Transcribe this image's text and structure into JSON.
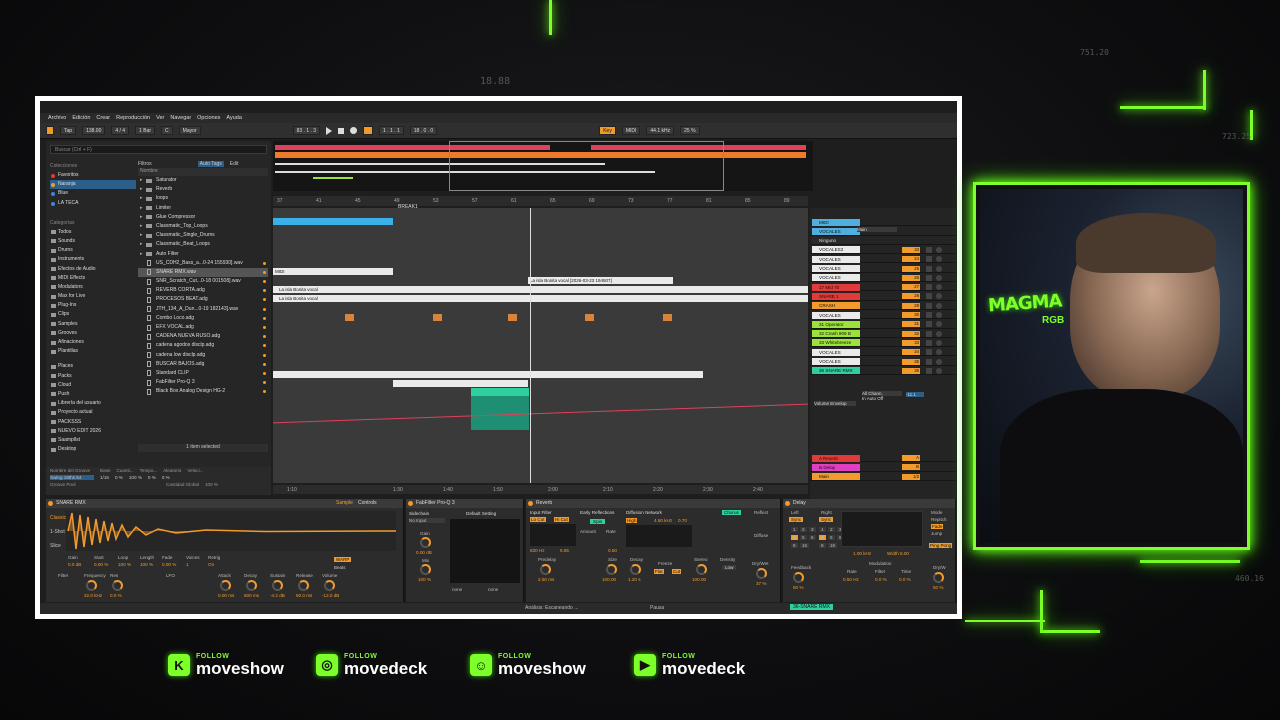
{
  "stream": {
    "bg_numbers": [
      "18.88",
      "751.20",
      "723.25",
      "460.16"
    ],
    "socials": [
      {
        "icon": "kick-icon",
        "glyph": "K",
        "follow": "FOLLOW",
        "handle": "moveshow"
      },
      {
        "icon": "instagram-icon",
        "glyph": "◎",
        "follow": "FOLLOW",
        "handle": "movedeck"
      },
      {
        "icon": "discord-icon",
        "glyph": "☺",
        "follow": "FOLLOW",
        "handle": "moveshow"
      },
      {
        "icon": "youtube-icon",
        "glyph": "▶",
        "follow": "FOLLOW",
        "handle": "movedeck"
      }
    ],
    "webcam": {
      "logo_main": "MAGMA",
      "logo_sub": "RGB"
    },
    "accent": "#7dff2a"
  },
  "ableton": {
    "menu": [
      "Archivo",
      "Edición",
      "Crear",
      "Reproducción",
      "Ver",
      "Navegar",
      "Opciones",
      "Ayuda"
    ],
    "transport": {
      "tap": "Tap",
      "tempo": "138.00",
      "signature": "4 / 4",
      "quant": "1 Bar",
      "key": "C",
      "scale": "Mayor",
      "position": "83 . 1 . 3",
      "loop_start": "1 . 1 . 1",
      "loop_len": "18 . 0 . 0",
      "key_btn": "Key",
      "midi": "MIDI",
      "sample_rate": "44.1 kHz",
      "cpu": "25 %"
    },
    "browser": {
      "search": "Buscar (Ctrl + F)",
      "collections_header": "Colecciones",
      "collections": [
        {
          "label": "Favoritos",
          "color": "#e03a3a"
        },
        {
          "label": "Naranja",
          "color": "#f29b2c"
        },
        {
          "label": "Blue",
          "color": "#3a86e0"
        },
        {
          "label": "LA TECA",
          "color": "#3a86e0"
        }
      ],
      "categories_header": "Categorías",
      "categories": [
        "Todos",
        "Sounds",
        "Drums",
        "Instruments",
        "Efectos de Audio",
        "MIDI Effects",
        "Modulators",
        "Max for Live",
        "Plug-Ins",
        "Clips",
        "Samples",
        "Grooves",
        "Afinaciones",
        "Plantillas"
      ],
      "places_header": "Places",
      "places": [
        "Places",
        "Packs",
        "Cloud",
        "Push",
        "Librería del usuario",
        "Proyecto actual",
        "PACKSSS",
        "NUEVO EDIT 2026",
        "Saampllst",
        "Desktop"
      ],
      "filter_label": "Filtros",
      "auto_tags": "Auto Tags",
      "edit": "Edit",
      "name_header": "Nombre",
      "files": [
        {
          "name": "Saturator",
          "type": "folder"
        },
        {
          "name": "Reverb",
          "type": "folder"
        },
        {
          "name": "loops",
          "type": "folder"
        },
        {
          "name": "Limiter",
          "type": "folder"
        },
        {
          "name": "Glue Compressor",
          "type": "folder"
        },
        {
          "name": "Classmatic_Top_Loops",
          "type": "folder"
        },
        {
          "name": "Classmatic_Single_Drums",
          "type": "folder"
        },
        {
          "name": "Classmatic_Beat_Loops",
          "type": "folder"
        },
        {
          "name": "Auto Filter",
          "type": "folder"
        },
        {
          "name": "US_CDH2_Bass_a...0-24 155930].wav",
          "type": "file"
        },
        {
          "name": "SNARE RMX.wav",
          "type": "file",
          "hl": true
        },
        {
          "name": "SNR_Scratch_Cut...0-18 001508].wav",
          "type": "file"
        },
        {
          "name": "REVERB CORTA.adg",
          "type": "file"
        },
        {
          "name": "PROCESOS BEAT.adg",
          "type": "file"
        },
        {
          "name": "JTH_134_A_Dun...0-19 182143].wav",
          "type": "file"
        },
        {
          "name": "Combo Loco.adg",
          "type": "file"
        },
        {
          "name": "EFX VOCAL.adg",
          "type": "file"
        },
        {
          "name": "CADENA NUEVA RUSO.adg",
          "type": "file"
        },
        {
          "name": "cadena agodos disclp.adg",
          "type": "file"
        },
        {
          "name": "cadena low disclp.adg",
          "type": "file"
        },
        {
          "name": "BUSCAR BAJOS.adg",
          "type": "file"
        },
        {
          "name": "Standard CLIP",
          "type": "file"
        },
        {
          "name": "FabFilter Pro-Q 3",
          "type": "file"
        },
        {
          "name": "Black Box Analog Design HG-2",
          "type": "file"
        }
      ],
      "selected_status": "1 item selected",
      "groove": {
        "header_name": "Nombre del Groove",
        "header_base": "Base",
        "header_quant": "Cuanti...",
        "header_timing": "Tempo...",
        "header_random": "Aleatorio",
        "header_vel": "Veloci...",
        "name": "Swing 16ths 54",
        "base": "1/16",
        "quant": "0 %",
        "timing": "100 %",
        "random": "0 %",
        "vel": "0 %",
        "pool": "Groove Pool",
        "global": "Cantidad Global",
        "global_val": "100 %"
      }
    },
    "ruler_bars": [
      "37",
      "41",
      "45",
      "49",
      "53",
      "57",
      "61",
      "65",
      "69",
      "73",
      "77",
      "81",
      "85",
      "89"
    ],
    "ruler_times": [
      "1:10",
      "1:30",
      "1:40",
      "1:50",
      "2:00",
      "2:10",
      "2:20",
      "2:30",
      "2:40"
    ],
    "locator": "BREAK1",
    "arr_clips": [
      {
        "lane": 6,
        "label": "MIDI",
        "color": "#eaeaea"
      },
      {
        "lane": 7,
        "label": "La isla Bonita vocal [2026-03-23 194507]",
        "color": "#eaeaea"
      },
      {
        "lane": 8,
        "label": "La isla Bonita vocal",
        "color": "#eaeaea"
      },
      {
        "lane": 9,
        "label": "La isla Bonita vocal",
        "color": "#eaeaea"
      }
    ],
    "tracks": [
      {
        "name": "MIDI",
        "color": "#4fb0e0",
        "num": ""
      },
      {
        "name": "VOCALES",
        "color": "#4fb0e0",
        "num": ""
      },
      {
        "name": "Ninguno",
        "color": "#2a2a2a",
        "num": ""
      },
      {
        "name": "VOCALES2",
        "color": "#eaeaea",
        "num": "33"
      },
      {
        "name": "VOCALES",
        "color": "#eaeaea",
        "num": "24"
      },
      {
        "name": "VOCALES",
        "color": "#eaeaea",
        "num": "25"
      },
      {
        "name": "VOCALES",
        "color": "#eaeaea",
        "num": "26"
      },
      {
        "name": "17 Mid 70",
        "color": "#e03a3a",
        "num": "27"
      },
      {
        "name": "SNARE 1",
        "color": "#e03a3a",
        "num": "28"
      },
      {
        "name": "CRASH",
        "color": "#f29b2c",
        "num": "29"
      },
      {
        "name": "VOCALES",
        "color": "#eaeaea",
        "num": "30"
      },
      {
        "name": "31 Operator",
        "color": "#9be23a",
        "num": "31"
      },
      {
        "name": "32 Crash 909 B",
        "color": "#9be23a",
        "num": "32"
      },
      {
        "name": "33 Whitebreeze",
        "color": "#9be23a",
        "num": "33"
      },
      {
        "name": "VOCALES",
        "color": "#eaeaea",
        "num": "34"
      },
      {
        "name": "VOCALES",
        "color": "#eaeaea",
        "num": "35"
      },
      {
        "name": "36 SNARE RMX",
        "color": "#2fd0a0",
        "num": "36"
      }
    ],
    "returns": [
      {
        "name": "A Reverb",
        "color": "#e03a3a",
        "num": "A"
      },
      {
        "name": "B Delay",
        "color": "#e040c0",
        "num": "B"
      },
      {
        "name": "Main",
        "color": "#f29b2c",
        "num": "1/2"
      }
    ],
    "track_io": {
      "in": "Main",
      "all_chan": "All Chann.",
      "in_auto_off": "In Auto Off",
      "volume_env": "Volume Envelop",
      "vol_val": "-11.1"
    },
    "devices": {
      "sampler": {
        "title": "SNARE RMX",
        "mode": "Sample",
        "controls": "Controls",
        "classic": "Classic",
        "one_shot": "1-Shot",
        "slice": "Slice",
        "params": [
          "Gain",
          "Start",
          "Loop",
          "Length",
          "Fade",
          "Voices",
          "Retrig"
        ],
        "values": [
          "0.0 dB",
          "0.00 %",
          "100 %",
          "100 %",
          "0.00 %",
          "1",
          "On"
        ],
        "warp": "WARP",
        "beats": "Beats",
        "lfo": "LFO",
        "filter": "Filter",
        "frequency": "Frequency",
        "res": "Res",
        "attack": "Attack",
        "decay": "Decay",
        "sustain": "Sustain",
        "release": "Release",
        "volume": "Volume",
        "fvals": [
          "22.0 kHz",
          "0.0 %",
          "0.00 ms",
          "600 ms",
          "-4.2 dB",
          "50.0 ms",
          "-12.0 dB"
        ]
      },
      "fabfilter": {
        "title": "FabFilter Pro-Q 3",
        "sidechain": "Sidechain",
        "noinput": "No Input",
        "gain": "Gain",
        "gain_val": "0.00 dB",
        "mix": "Mix",
        "mix_val": "100 %",
        "preset": "Default Setting",
        "none": "none"
      },
      "reverb": {
        "title": "Reverb",
        "input_filter": "Input Filter",
        "early": "Early Reflections",
        "diffusion": "Diffusion Network",
        "lo_cut": "Lo Cut",
        "hi_cut": "Hi Cut",
        "spin": "Spin",
        "amount": "Amount",
        "rate": "Rate",
        "high": "High",
        "shelf": "4.50 kHz",
        "shelf_amt": "0.70",
        "chorus": "Chorus",
        "predelay": "Predelay",
        "predelay_val": "2.50 ms",
        "size": "Size",
        "size_val": "100.00",
        "decay": "Decay",
        "decay_val": "1.20 s",
        "freeze": "Freeze",
        "flat": "Flat",
        "cut": "Cut",
        "stereo": "Stereo",
        "stereo_val": "100.00",
        "density": "Density",
        "density_val": "Low",
        "reflect": "Reflect",
        "diffuse": "Diffuse",
        "drywet": "Dry/Wet",
        "drywet_val": "37 %",
        "freq_val": "830 Hz",
        "width_val": "5.65",
        "shape_val": "0.50"
      },
      "delay": {
        "title": "Delay",
        "left": "Left",
        "right": "Right",
        "sync": "Sync",
        "feedback": "Feedback",
        "feedback_val": "50 %",
        "filter": "Filter",
        "filter_freq": "1.00 kHz",
        "filter_width": "Width 8.00",
        "modulation": "Modulation",
        "rate": "Rate",
        "rate_val": "0.50 Hz",
        "mfilter": "Filter",
        "mfilter_val": "0.0 %",
        "time": "Time",
        "time_val": "0.0 %",
        "mode": "Mode",
        "repitch": "Repitch",
        "fade": "Fade",
        "jump": "Jump",
        "pingpong": "Ping Pong",
        "drywet": "Dry/W",
        "drywet_val": "50 %",
        "steps": [
          "1",
          "2",
          "3",
          "4",
          "5",
          "6",
          "8",
          "16"
        ]
      }
    },
    "status": {
      "analysis": "Análisis: Escaneando ...",
      "pause": "Pausa",
      "track": "36-SNARE RMX"
    }
  }
}
